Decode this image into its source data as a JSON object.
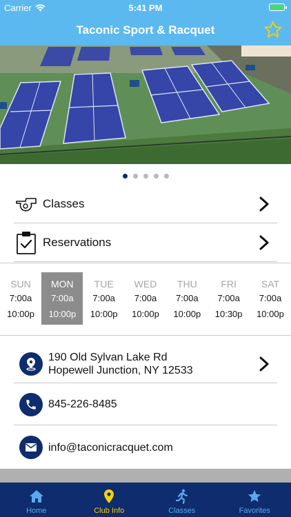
{
  "status_bar": {
    "carrier": "Carrier",
    "time": "5:41 PM",
    "battery_level": 1.0,
    "battery_color": "#4cd964"
  },
  "nav": {
    "title": "Taconic Sport & Racquet",
    "favorite_icon": "star-outline-icon"
  },
  "hero": {
    "image": "aerial view of tennis courts",
    "page_count": 5,
    "current_page": 1
  },
  "menu": [
    {
      "label": "Classes",
      "icon": "whistle-icon"
    },
    {
      "label": "Reservations",
      "icon": "clipboard-check-icon"
    }
  ],
  "hours": [
    {
      "day": "SUN",
      "open": "7:00a",
      "close": "10:00p",
      "today": false
    },
    {
      "day": "MON",
      "open": "7:00a",
      "close": "10:00p",
      "today": true
    },
    {
      "day": "TUE",
      "open": "7:00a",
      "close": "10:00p",
      "today": false
    },
    {
      "day": "WED",
      "open": "7:00a",
      "close": "10:00p",
      "today": false
    },
    {
      "day": "THU",
      "open": "7:00a",
      "close": "10:00p",
      "today": false
    },
    {
      "day": "FRI",
      "open": "7:00a",
      "close": "10:30p",
      "today": false
    },
    {
      "day": "SAT",
      "open": "7:00a",
      "close": "10:00p",
      "today": false
    }
  ],
  "contact": {
    "address_line1": "190 Old Sylvan Lake Rd",
    "address_line2": "Hopewell Junction, NY 12533",
    "phone": "845-226-8485",
    "email": "info@taconicracquet.com"
  },
  "tabs": [
    {
      "label": "Home",
      "icon": "home-icon",
      "active": false
    },
    {
      "label": "Club Info",
      "icon": "map-pin-icon",
      "active": true
    },
    {
      "label": "Classes",
      "icon": "runner-icon",
      "active": false
    },
    {
      "label": "Favorites",
      "icon": "star-icon",
      "active": false
    }
  ],
  "colors": {
    "header": "#5bb9f0",
    "navy": "#0e2c6e",
    "tab_inactive": "#5aa9ec",
    "tab_active": "#f5d100",
    "today_bg": "#8c8c8c"
  }
}
